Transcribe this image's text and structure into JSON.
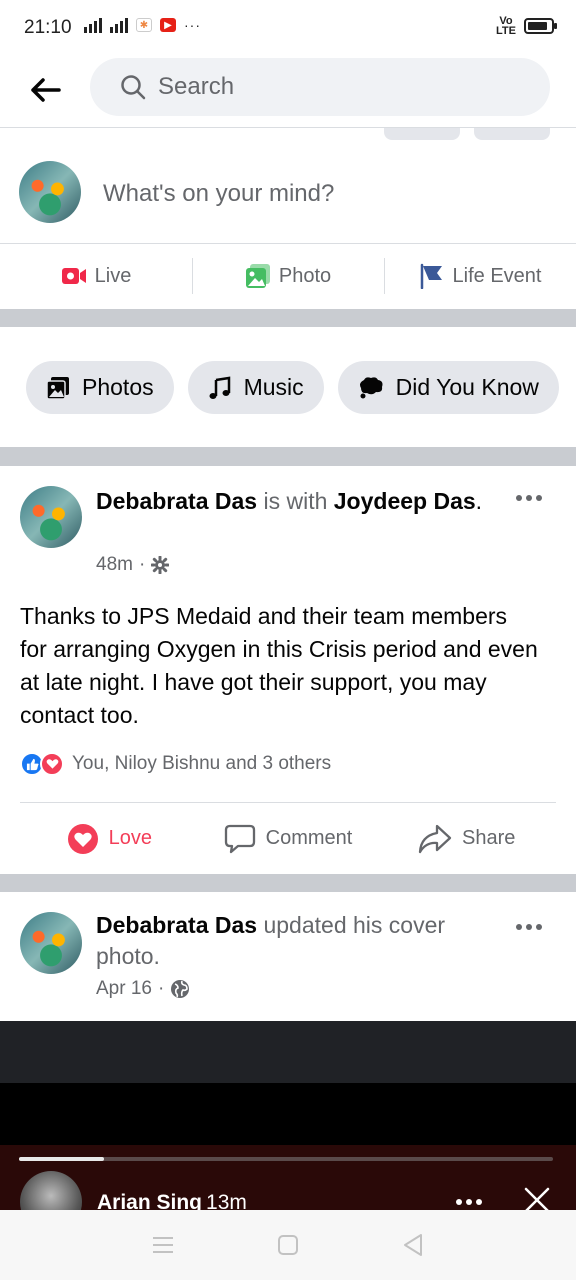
{
  "status_bar": {
    "time": "21:10",
    "network": "4G",
    "volte": "Vo\nLTE",
    "battery_level": 0.85
  },
  "search": {
    "placeholder": "Search"
  },
  "composer": {
    "prompt": "What's on your mind?"
  },
  "composer_actions": [
    {
      "label": "Live",
      "icon": "live-video-icon",
      "color": "#f02849"
    },
    {
      "label": "Photo",
      "icon": "photo-icon",
      "color": "#45bd62"
    },
    {
      "label": "Life Event",
      "icon": "flag-icon",
      "color": "#3b5998"
    }
  ],
  "chips": [
    {
      "label": "Photos",
      "icon": "photos-icon"
    },
    {
      "label": "Music",
      "icon": "music-note-icon"
    },
    {
      "label": "Did You Know",
      "icon": "speech-bubble-icon"
    }
  ],
  "post1": {
    "author": "Debabrata Das",
    "connector": " is with ",
    "tagged": "Joydeep Das",
    "time": "48m",
    "privacy_icon": "gear-icon",
    "text": "Thanks to JPS Medaid and their team members for arranging Oxygen in this Crisis period and even at late night. I have got their support, you may contact too.",
    "reactions_text": "You, Niloy Bishnu and 3 others",
    "actions": {
      "love": "Love",
      "comment": "Comment",
      "share": "Share"
    }
  },
  "post2": {
    "author": "Debabrata Das",
    "action_text": " updated his cover photo.",
    "time": "Apr 16",
    "privacy_icon": "globe-icon"
  },
  "story": {
    "user": "Arian Sing",
    "time": "13m",
    "progress": 0.16
  }
}
